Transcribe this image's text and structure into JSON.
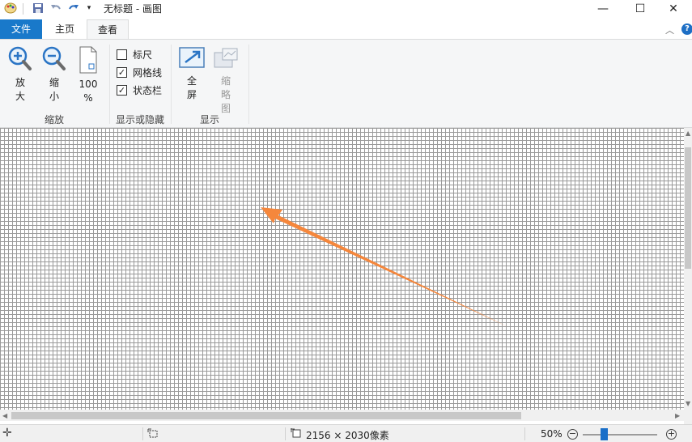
{
  "window": {
    "title": "无标题 - 画图",
    "minimize": "—",
    "maximize": "☐",
    "close": "✕"
  },
  "tabs": [
    {
      "label": "文件"
    },
    {
      "label": "主页"
    },
    {
      "label": "查看"
    }
  ],
  "ribbon": {
    "zoom_group": {
      "label": "缩放",
      "zoom_in": "放大",
      "zoom_out": "缩小",
      "hundred_line1": "100",
      "hundred_line2": "%"
    },
    "show_hide_group": {
      "label": "显示或隐藏",
      "ruler": {
        "label": "标尺",
        "checked": false
      },
      "gridlines": {
        "label": "网格线",
        "checked": true
      },
      "statusbar": {
        "label": "状态栏",
        "checked": true
      }
    },
    "display_group": {
      "label": "显示",
      "fullscreen": "全屏",
      "thumbnail": "缩略图"
    }
  },
  "statusbar": {
    "dimensions": "2156 × 2030像素",
    "zoom_level": "50%"
  },
  "colors": {
    "file_tab": "#1979ca",
    "arrow": "#f5873c",
    "zoom_thumb": "#1a6fc8"
  }
}
